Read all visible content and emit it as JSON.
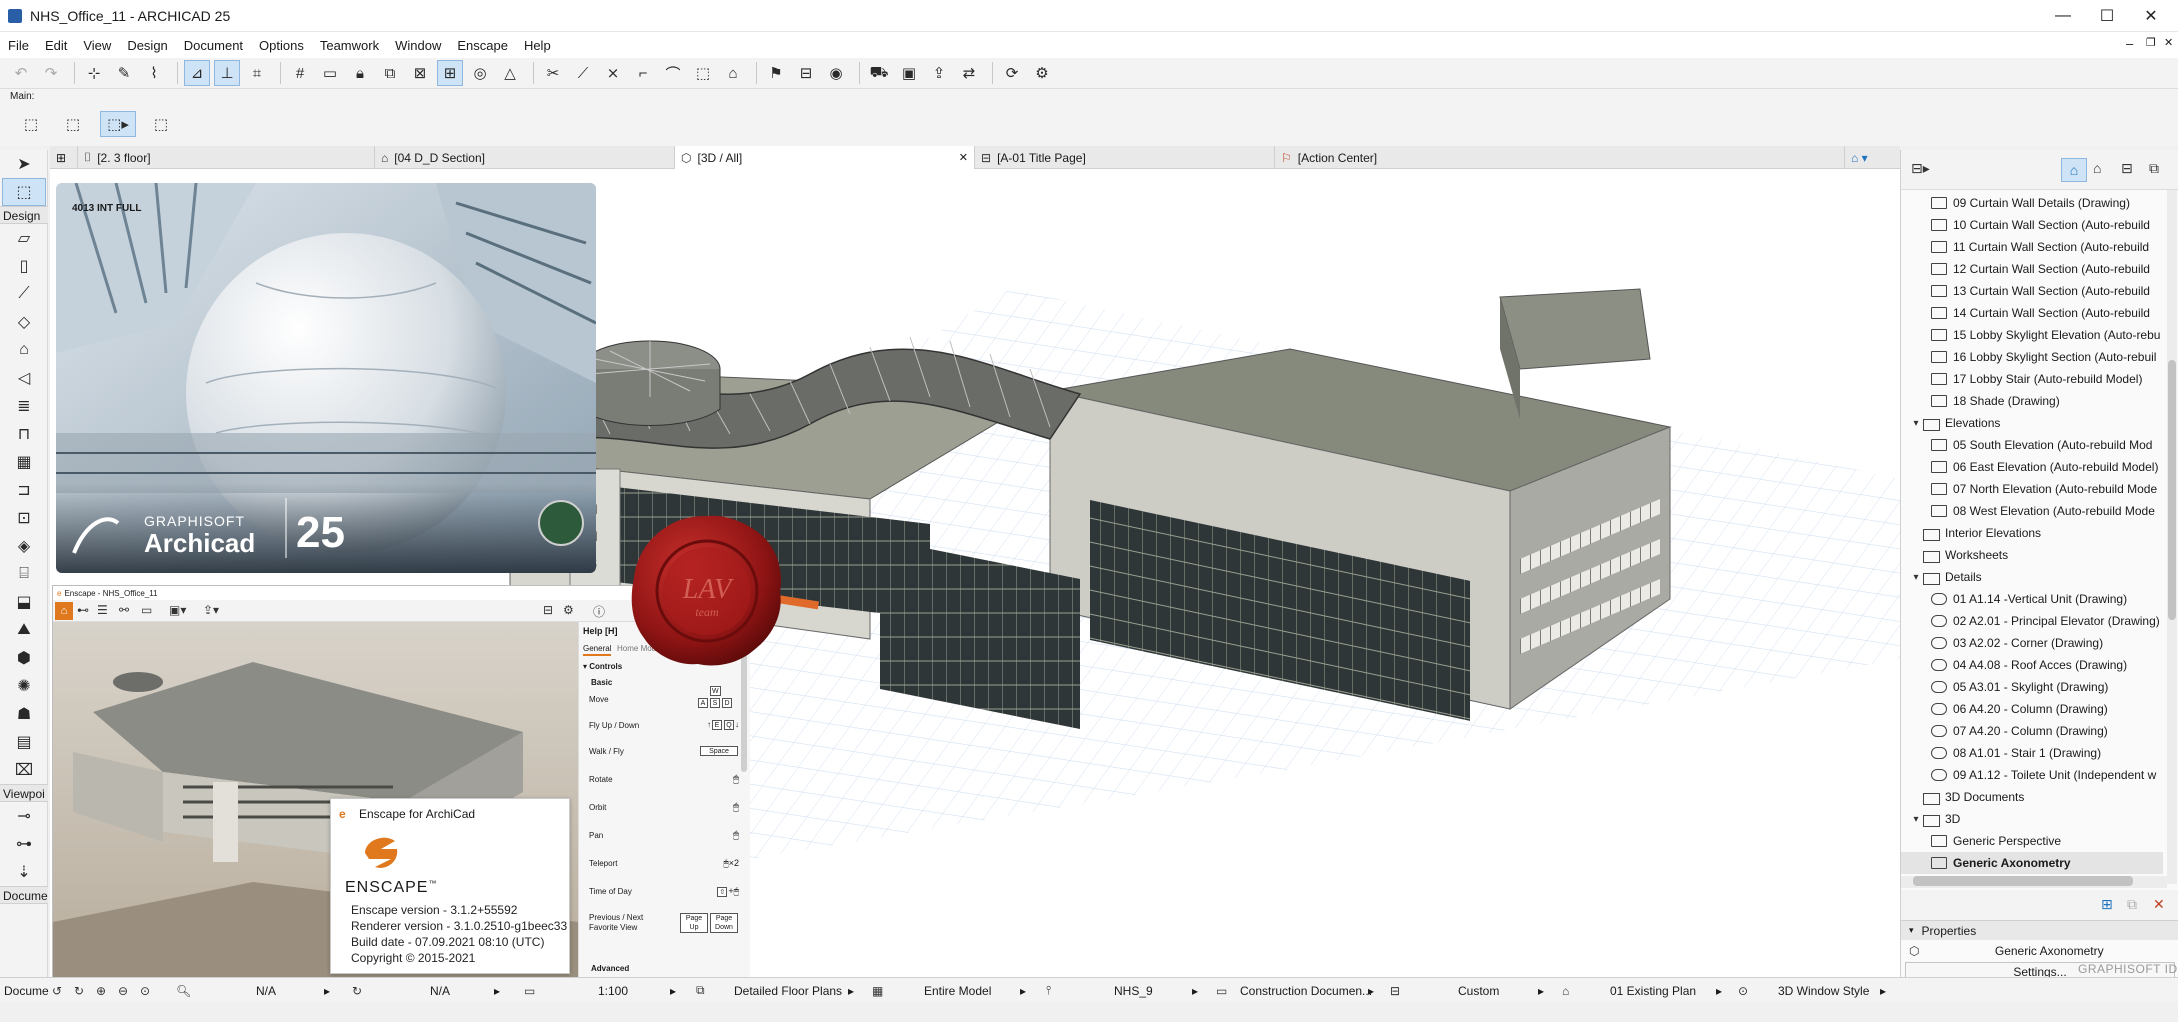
{
  "window": {
    "title": "NHS_Office_11 - ARCHICAD 25",
    "minimize": "—",
    "maximize": "☐",
    "close": "✕"
  },
  "menu": [
    "File",
    "Edit",
    "View",
    "Design",
    "Document",
    "Options",
    "Teamwork",
    "Window",
    "Enscape",
    "Help"
  ],
  "info_box": {
    "label": "Main:"
  },
  "toolbox": {
    "design_label": "Design",
    "viewpoint_label": "Viewpoi",
    "document_label": "Docume"
  },
  "tabs": [
    {
      "label": "[2. 3 floor]"
    },
    {
      "label": "[04 D_D Section]"
    },
    {
      "label": "[3D / All]"
    },
    {
      "label": "[A-01 Title Page]"
    },
    {
      "label": "[Action Center]"
    }
  ],
  "tab_close": "✕",
  "splash": {
    "badge": "4013 INT FULL",
    "brand_top": "GRAPHISOFT",
    "brand_name": "Archicad",
    "version": "25"
  },
  "enscape": {
    "window_title": "Enscape - NHS_Office_11",
    "help_title": "Help [H]",
    "help_tabs": [
      "General",
      "Home Mode"
    ],
    "controls_label": "Controls",
    "basic_label": "Basic",
    "advanced_label": "Advanced",
    "controls": [
      {
        "label": "Move",
        "keys": "W A S D"
      },
      {
        "label": "Fly Up / Down",
        "keys": "E Q"
      },
      {
        "label": "Walk / Fly",
        "keys": "Space"
      },
      {
        "label": "Rotate",
        "keys": ""
      },
      {
        "label": "Orbit",
        "keys": ""
      },
      {
        "label": "Pan",
        "keys": ""
      },
      {
        "label": "Teleport",
        "keys": "×2"
      },
      {
        "label": "Time of Day",
        "keys": ""
      },
      {
        "label": "Previous / Next Favorite View",
        "keys": "Page Up  Page Down"
      }
    ],
    "key_w": "W",
    "key_a": "A",
    "key_s": "S",
    "key_d": "D",
    "key_e": "E",
    "key_q": "Q",
    "key_space": "Space",
    "key_pgup": "Page Up",
    "key_pgdn": "Page Down",
    "teleport_x2": "×2",
    "about": {
      "title": "Enscape for ArchiCad",
      "logo_text": "ENSCAPE",
      "tm": "™",
      "lines": [
        "Enscape version - 3.1.2+55592",
        "Renderer version - 3.1.0.2510-g1beec33",
        "Build date - 07.09.2021 08:10 (UTC)",
        "Copyright © 2015-2021"
      ]
    }
  },
  "seal": {
    "text": "LAV",
    "subtext": "team"
  },
  "navigator": {
    "rows": [
      {
        "label": "09 Curtain Wall Details (Drawing)",
        "indent": 2,
        "kind": "view"
      },
      {
        "label": "10 Curtain Wall Section (Auto-rebuild",
        "indent": 2,
        "kind": "view"
      },
      {
        "label": "11 Curtain Wall Section (Auto-rebuild",
        "indent": 2,
        "kind": "view"
      },
      {
        "label": "12 Curtain Wall Section (Auto-rebuild",
        "indent": 2,
        "kind": "view"
      },
      {
        "label": "13 Curtain Wall Section (Auto-rebuild",
        "indent": 2,
        "kind": "view"
      },
      {
        "label": "14 Curtain Wall Section (Auto-rebuild",
        "indent": 2,
        "kind": "view"
      },
      {
        "label": "15 Lobby Skylight Elevation (Auto-rebu",
        "indent": 2,
        "kind": "view"
      },
      {
        "label": "16 Lobby Skylight Section (Auto-rebuil",
        "indent": 2,
        "kind": "view"
      },
      {
        "label": "17 Lobby Stair (Auto-rebuild Model)",
        "indent": 2,
        "kind": "view"
      },
      {
        "label": "18 Shade (Drawing)",
        "indent": 2,
        "kind": "view"
      },
      {
        "label": "Elevations",
        "indent": 1,
        "kind": "folder-open"
      },
      {
        "label": "05 South Elevation (Auto-rebuild Mod",
        "indent": 2,
        "kind": "view"
      },
      {
        "label": "06 East Elevation (Auto-rebuild Model)",
        "indent": 2,
        "kind": "view"
      },
      {
        "label": "07 North Elevation (Auto-rebuild Mode",
        "indent": 2,
        "kind": "view"
      },
      {
        "label": "08 West Elevation (Auto-rebuild Mode",
        "indent": 2,
        "kind": "view"
      },
      {
        "label": "Interior Elevations",
        "indent": 1,
        "kind": "folder"
      },
      {
        "label": "Worksheets",
        "indent": 1,
        "kind": "folder"
      },
      {
        "label": "Details",
        "indent": 1,
        "kind": "folder-open"
      },
      {
        "label": "01 A1.14 -Vertical Unit (Drawing)",
        "indent": 2,
        "kind": "detail"
      },
      {
        "label": "02 A2.01 - Principal Elevator (Drawing)",
        "indent": 2,
        "kind": "detail"
      },
      {
        "label": "03 A2.02 - Corner (Drawing)",
        "indent": 2,
        "kind": "detail"
      },
      {
        "label": "04 A4.08 - Roof Acces (Drawing)",
        "indent": 2,
        "kind": "detail"
      },
      {
        "label": "05 A3.01 - Skylight (Drawing)",
        "indent": 2,
        "kind": "detail"
      },
      {
        "label": "06 A4.20 - Column (Drawing)",
        "indent": 2,
        "kind": "detail"
      },
      {
        "label": "07 A4.20 - Column (Drawing)",
        "indent": 2,
        "kind": "detail"
      },
      {
        "label": "08 A1.01 - Stair 1 (Drawing)",
        "indent": 2,
        "kind": "detail"
      },
      {
        "label": "09 A1.12 - Toilete Unit (Independent w",
        "indent": 2,
        "kind": "detail"
      },
      {
        "label": "3D Documents",
        "indent": 1,
        "kind": "folder"
      },
      {
        "label": "3D",
        "indent": 1,
        "kind": "folder-open"
      },
      {
        "label": "Generic Perspective",
        "indent": 2,
        "kind": "view3d"
      },
      {
        "label": "Generic Axonometry",
        "indent": 2,
        "kind": "view3d",
        "selected": true
      }
    ],
    "properties_label": "Properties",
    "properties_value": "Generic Axonometry",
    "settings_button": "Settings...",
    "footer_brand": "GRAPHISOFT ID"
  },
  "statusbar": {
    "na1": "N/A",
    "na2": "N/A",
    "scale": "1:100",
    "layer_combo": "Detailed Floor Plans",
    "model_view": "Entire Model",
    "pen_set": "NHS_9",
    "graphic_override": "Construction Documen...",
    "dimension": "Custom",
    "renovation": "01 Existing Plan",
    "window_style": "3D Window Style"
  },
  "colors": {
    "accent": "#1e73be",
    "selection": "#cfe3f6",
    "seal": "#8e1414",
    "grid": "#c9daf0"
  }
}
